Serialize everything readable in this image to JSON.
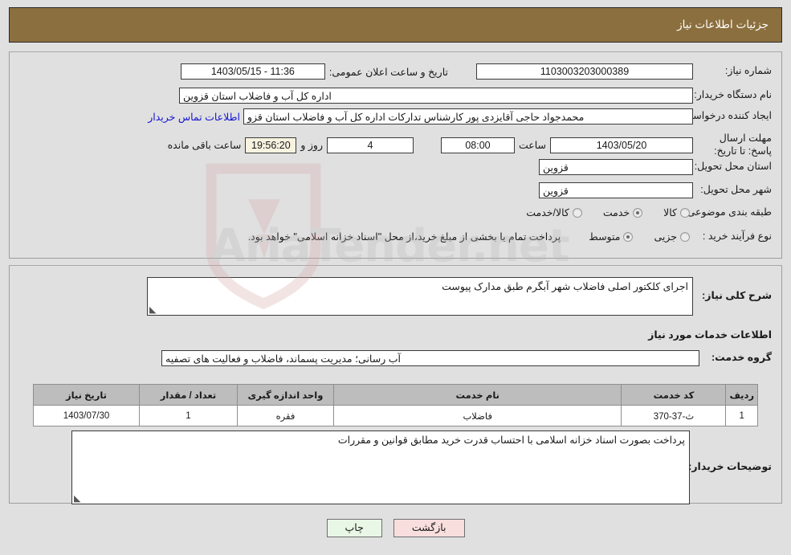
{
  "header": {
    "title": "جزئیات اطلاعات نیاز",
    "bg_color": "#8c6f3e"
  },
  "form": {
    "need_number_label": "شماره نیاز:",
    "need_number_value": "1103003203000389",
    "public_announce_label": "تاریخ و ساعت اعلان عمومی:",
    "public_announce_value": "11:36 - 1403/05/15",
    "buyer_org_label": "نام دستگاه خریدار:",
    "buyer_org_value": "اداره کل آب و فاضلاب استان قزوین",
    "requester_label": "ایجاد کننده درخواست:",
    "requester_value": "محمدجواد حاجی آقایزدی پور کارشناس تدارکات اداره کل آب و فاضلاب استان قزو",
    "buyer_contact_link": "اطلاعات تماس خریدار",
    "deadline_label": "مهلت ارسال پاسخ: تا تاریخ:",
    "deadline_date": "1403/05/20",
    "deadline_hour_label": "ساعت",
    "deadline_hour": "08:00",
    "remaining_days": "4",
    "remaining_days_label": "روز و",
    "remaining_time": "19:56:20",
    "remaining_time_label": "ساعت باقی مانده",
    "province_label": "استان محل تحویل:",
    "province_value": "قزوین",
    "city_label": "شهر محل تحویل:",
    "city_value": "قزوین",
    "category_label": "طبقه بندی موضوعی:",
    "category_options": [
      {
        "label": "کالا",
        "selected": false
      },
      {
        "label": "خدمت",
        "selected": true
      },
      {
        "label": "کالا/خدمت",
        "selected": false
      }
    ],
    "process_type_label": "نوع فرآیند خرید :",
    "process_type_options": [
      {
        "label": "جزیی",
        "selected": false
      },
      {
        "label": "متوسط",
        "selected": true
      }
    ],
    "process_note": "پرداخت تمام یا بخشی از مبلغ خرید،از محل \"اسناد خزانه اسلامی\" خواهد بود."
  },
  "need_summary": {
    "label": "شرح کلی نیاز:",
    "value": "اجرای کلکتور اصلی فاضلاب شهر آبگرم طبق مدارک پیوست"
  },
  "services_section": {
    "heading": "اطلاعات خدمات مورد نیاز",
    "service_group_label": "گروه خدمت:",
    "service_group_value": "آب رسانی؛ مدیریت پسماند، فاضلاب و فعالیت های تصفیه"
  },
  "items_table": {
    "columns": [
      "ردیف",
      "کد خدمت",
      "نام خدمت",
      "واحد اندازه گیری",
      "تعداد / مقدار",
      "تاریخ نیاز"
    ],
    "rows": [
      {
        "row_no": "1",
        "service_code": "ث-37-370",
        "service_name": "فاضلاب",
        "unit": "فقره",
        "quantity": "1",
        "need_date": "1403/07/30"
      }
    ]
  },
  "buyer_notes": {
    "label": "توضیحات خریدار:",
    "value": "پرداخت بصورت اسناد خزانه اسلامی با احتساب قدرت خرید مطابق قوانین و مقررات"
  },
  "buttons": {
    "print": "چاپ",
    "back": "بازگشت"
  },
  "watermark": {
    "text": "AriaTender.net"
  }
}
